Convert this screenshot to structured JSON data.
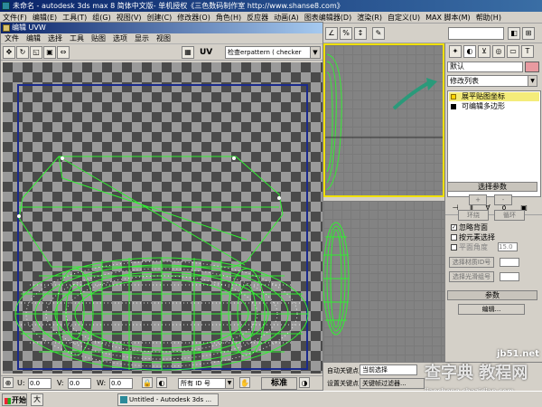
{
  "main": {
    "title": "未命名 - autodesk 3ds max 8 简体中文版- 单机授权《三色数码制作室 http://www.shanse8.com》",
    "menu": [
      "文件(F)",
      "编辑(E)",
      "工具(T)",
      "组(G)",
      "视图(V)",
      "创建(C)",
      "修改器(O)",
      "角色(H)",
      "反应器",
      "动画(A)",
      "图表编辑器(D)",
      "渲染(R)",
      "自定义(U)",
      "MAX 脚本(M)",
      "帮助(H)"
    ]
  },
  "uv_editor": {
    "title": "编辑 UVW",
    "menu": [
      "文件",
      "编辑",
      "选择",
      "工具",
      "贴图",
      "选项",
      "显示",
      "视图"
    ],
    "uv_label": "UV",
    "texture_select": "检查erpattern  ( checker",
    "u_label": "U:",
    "u_value": "0.0",
    "v_label": "V:",
    "v_value": "0.0",
    "w_label": "W:",
    "w_value": "0.0",
    "id_select": "所有 ID 号",
    "std_button": "标准"
  },
  "command_panel": {
    "object_name": "默认",
    "object_color": "#e89aa0",
    "modifier_list": "修改列表",
    "stack": [
      "展平贴图坐标",
      "可编辑多边形"
    ],
    "selection_rollout": {
      "title": "选择参数",
      "plus": "+",
      "minus": "-",
      "ring": "环绕",
      "loop": "循环",
      "ignore_backfacing": "忽略背面",
      "select_by_element": "按元素选择",
      "planar_angle": "平面角度",
      "planar_value": "15.0",
      "select_mat_id": "选择材质ID号",
      "select_smooth_group": "选择光滑组号"
    },
    "parameters_rollout": {
      "title": "参数",
      "edit_button": "编辑..."
    }
  },
  "bottom": {
    "key_filter_label": "自动关键点",
    "selection_select": "当前选择",
    "set_key_label": "设置关键点",
    "key_filters": "关键帧过滤器..."
  },
  "taskbar": {
    "start": "开始",
    "task_item": "Untitled - Autodesk 3ds ..."
  },
  "watermark": {
    "main": "查字典 教程网",
    "site": "jiaocheng.chazidian.com",
    "corner": "jb51.net"
  },
  "colors": {
    "wire": "#33ee33",
    "selected_wire": "#ffffff",
    "active_viewport": "#f0e000",
    "arrow": "#2a9a7a"
  }
}
